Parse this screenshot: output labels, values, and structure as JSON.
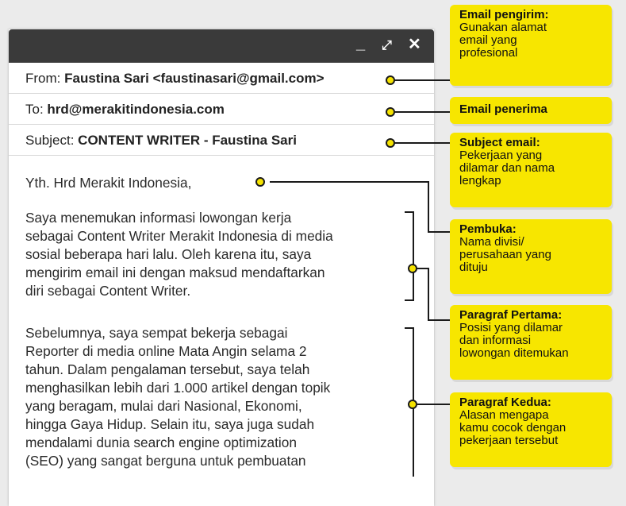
{
  "window": {
    "controls": {
      "minimize": "_",
      "maximize": "⤢",
      "close": "✕"
    },
    "from_label": "From:",
    "from_value": "Faustina Sari <faustinasari@gmail.com>",
    "to_label": "To:",
    "to_value": "hrd@merakitindonesia.com",
    "subject_label": "Subject:",
    "subject_value": "CONTENT WRITER - Faustina Sari",
    "greeting": "Yth. Hrd Merakit Indonesia,",
    "paragraph1": [
      "Saya menemukan informasi lowongan kerja",
      "sebagai Content Writer Merakit Indonesia di media",
      "sosial beberapa hari lalu. Oleh karena itu, saya",
      "mengirim email ini dengan maksud mendaftarkan",
      "diri sebagai Content Writer."
    ],
    "paragraph2": [
      "Sebelumnya, saya sempat bekerja sebagai",
      "Reporter di media online Mata Angin selama 2",
      "tahun. Dalam pengalaman tersebut, saya telah",
      "menghasilkan lebih dari 1.000 artikel dengan topik",
      "yang beragam, mulai dari Nasional, Ekonomi,",
      "hingga Gaya Hidup. Selain itu, saya juga sudah",
      "mendalami dunia search engine optimization",
      "(SEO) yang sangat berguna untuk pembuatan"
    ]
  },
  "callouts": [
    {
      "title": "Email pengirim:",
      "lines": [
        "Gunakan alamat",
        "email yang",
        "profesional"
      ]
    },
    {
      "title": "Email penerima",
      "lines": []
    },
    {
      "title": "Subject email:",
      "lines": [
        "Pekerjaan yang",
        "dilamar dan nama",
        "lengkap"
      ]
    },
    {
      "title": "Pembuka:",
      "lines": [
        "Nama divisi/",
        "perusahaan yang",
        "dituju"
      ]
    },
    {
      "title": "Paragraf Pertama:",
      "lines": [
        "Posisi yang dilamar",
        "dan informasi",
        "lowongan ditemukan"
      ]
    },
    {
      "title": "Paragraf Kedua:",
      "lines": [
        "Alasan mengapa",
        "kamu cocok dengan",
        "pekerjaan tersebut"
      ]
    }
  ],
  "colors": {
    "callout": "#f7e600",
    "titlebar": "#3a3a3a",
    "background": "#ebebeb"
  }
}
